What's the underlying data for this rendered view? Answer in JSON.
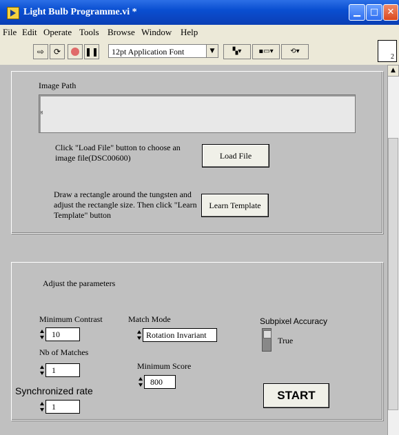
{
  "window": {
    "title": "Light Bulb Programme.vi *",
    "buttons": [
      "minimize",
      "maximize",
      "close"
    ]
  },
  "menu": [
    "File",
    "Edit",
    "Operate",
    "Tools",
    "Browse",
    "Window",
    "Help"
  ],
  "toolbar": {
    "font_select": "12pt Application Font",
    "vi_icon_label": "2"
  },
  "panel": {
    "image_path": {
      "label": "Image Path",
      "value": ""
    },
    "load_instructions": "Click \"Load File\" button to choose an image file(DSC00600)",
    "load_button": "Load File",
    "learn_instructions": "Draw a rectangle around the tungsten and adjust the rectangle size. Then click \"Learn Template\" button",
    "learn_button": "Learn Template",
    "params_heading": "Adjust the parameters",
    "min_contrast": {
      "label": "Minimum Contrast",
      "value": "10"
    },
    "nb_matches": {
      "label": "Nb of Matches",
      "value": "1"
    },
    "sync_rate": {
      "label": "Synchronized rate",
      "value": "1"
    },
    "match_mode": {
      "label": "Match Mode",
      "value": "Rotation Invariant"
    },
    "min_score": {
      "label": "Minimum Score",
      "value": "800"
    },
    "subpixel": {
      "label": "Subpixel Accuracy",
      "value": "True"
    },
    "start_button": "START"
  }
}
